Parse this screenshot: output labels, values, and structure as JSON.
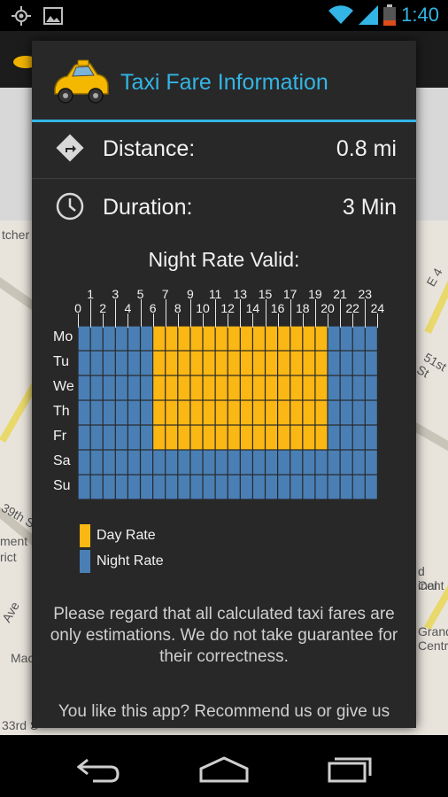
{
  "status_bar": {
    "time": "1:40",
    "icons": [
      "gps-icon",
      "picture-icon",
      "wifi-icon",
      "signal-icon",
      "battery-icon"
    ]
  },
  "map": {
    "labels": [
      "tcher",
      "39th St",
      "ment",
      "rict",
      "Mac",
      "33rd S",
      "E 4",
      "51st St",
      "d Cent",
      "inal",
      "Grand",
      "Centr",
      "Ave"
    ]
  },
  "dialog": {
    "title": "Taxi Fare Information",
    "distance": {
      "label": "Distance:",
      "value": "0.8 mi"
    },
    "duration": {
      "label": "Duration:",
      "value": "3 Min"
    },
    "grid_title": "Night Rate Valid:",
    "hours_odd": [
      "1",
      "3",
      "5",
      "7",
      "9",
      "11",
      "13",
      "15",
      "17",
      "19",
      "21",
      "23"
    ],
    "hours_even": [
      "0",
      "2",
      "4",
      "6",
      "8",
      "10",
      "12",
      "14",
      "16",
      "18",
      "20",
      "22",
      "24"
    ],
    "days": [
      "Mo",
      "Tu",
      "We",
      "Th",
      "Fr",
      "Sa",
      "Su"
    ],
    "rate_grid": {
      "Mo": [
        "N",
        "N",
        "N",
        "N",
        "N",
        "N",
        "D",
        "D",
        "D",
        "D",
        "D",
        "D",
        "D",
        "D",
        "D",
        "D",
        "D",
        "D",
        "D",
        "D",
        "N",
        "N",
        "N",
        "N"
      ],
      "Tu": [
        "N",
        "N",
        "N",
        "N",
        "N",
        "N",
        "D",
        "D",
        "D",
        "D",
        "D",
        "D",
        "D",
        "D",
        "D",
        "D",
        "D",
        "D",
        "D",
        "D",
        "N",
        "N",
        "N",
        "N"
      ],
      "We": [
        "N",
        "N",
        "N",
        "N",
        "N",
        "N",
        "D",
        "D",
        "D",
        "D",
        "D",
        "D",
        "D",
        "D",
        "D",
        "D",
        "D",
        "D",
        "D",
        "D",
        "N",
        "N",
        "N",
        "N"
      ],
      "Th": [
        "N",
        "N",
        "N",
        "N",
        "N",
        "N",
        "D",
        "D",
        "D",
        "D",
        "D",
        "D",
        "D",
        "D",
        "D",
        "D",
        "D",
        "D",
        "D",
        "D",
        "N",
        "N",
        "N",
        "N"
      ],
      "Fr": [
        "N",
        "N",
        "N",
        "N",
        "N",
        "N",
        "D",
        "D",
        "D",
        "D",
        "D",
        "D",
        "D",
        "D",
        "D",
        "D",
        "D",
        "D",
        "D",
        "D",
        "N",
        "N",
        "N",
        "N"
      ],
      "Sa": [
        "N",
        "N",
        "N",
        "N",
        "N",
        "N",
        "N",
        "N",
        "N",
        "N",
        "N",
        "N",
        "N",
        "N",
        "N",
        "N",
        "N",
        "N",
        "N",
        "N",
        "N",
        "N",
        "N",
        "N"
      ],
      "Su": [
        "N",
        "N",
        "N",
        "N",
        "N",
        "N",
        "N",
        "N",
        "N",
        "N",
        "N",
        "N",
        "N",
        "N",
        "N",
        "N",
        "N",
        "N",
        "N",
        "N",
        "N",
        "N",
        "N",
        "N"
      ]
    },
    "legend": [
      {
        "label": "Day Rate",
        "color": "#fbb713"
      },
      {
        "label": "Night Rate",
        "color": "#4a7fb5"
      }
    ],
    "disclaimer": "Please regard that all calculated taxi fares are only estimations. We do not take guarantee for their correctness.",
    "recommend": "You like this app? Recommend us or give us"
  },
  "colors": {
    "accent": "#33b5e5",
    "day_rate": "#fbb713",
    "night_rate": "#4a7fb5",
    "dialog_bg": "#282828"
  }
}
